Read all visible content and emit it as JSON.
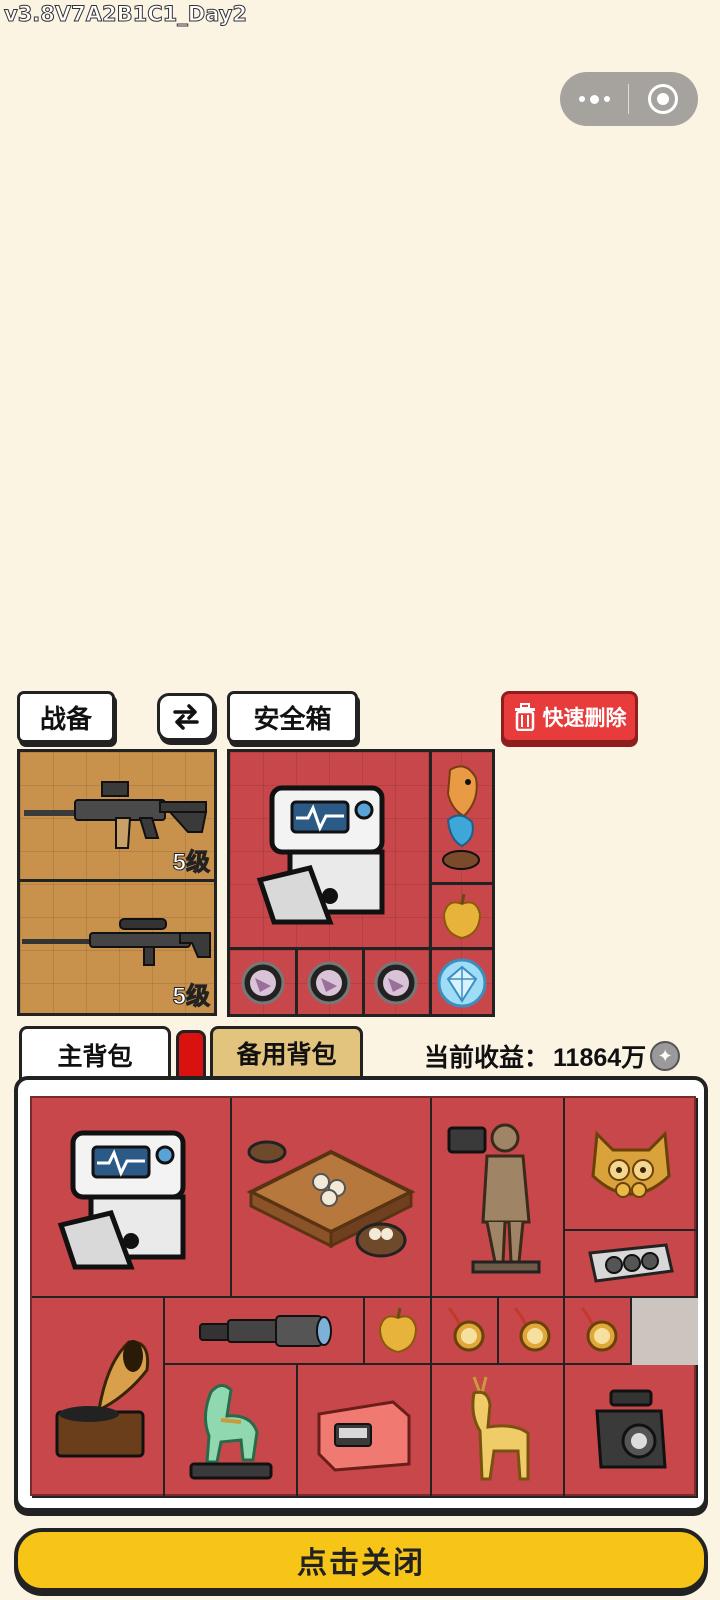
{
  "version": "v3.8V7A2B1C1_Day2",
  "top_tabs": {
    "gear_label": "战备",
    "safe_label": "安全箱",
    "quick_delete_label": "快速删除"
  },
  "gear": {
    "slots": [
      {
        "name": "assault-rifle",
        "level": "5级"
      },
      {
        "name": "sniper-rifle",
        "level": "5级"
      }
    ]
  },
  "bag_tabs": {
    "main_label": "主背包",
    "backup_label": "备用背包"
  },
  "earnings": {
    "label": "当前收益：",
    "value": "11864万"
  },
  "close_label": "点击关闭",
  "colors": {
    "background": "#fcf4e3",
    "grid_red": "#c8474a",
    "gear_tan": "#c8924d",
    "close_yellow": "#f6c517",
    "delete_red": "#e83b3b"
  }
}
